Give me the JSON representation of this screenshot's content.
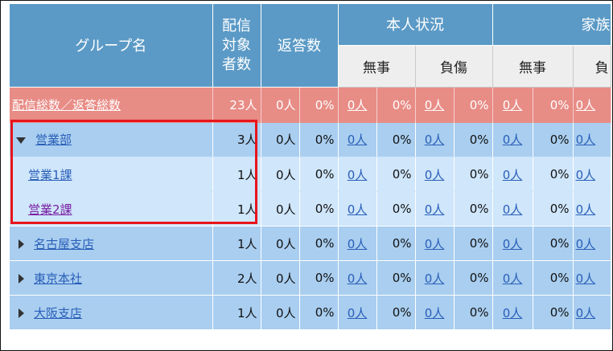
{
  "header": {
    "group_name": "グループ名",
    "recipients_line1": "配信",
    "recipients_line2": "対象",
    "recipients_line3": "者数",
    "responses": "返答数",
    "self_status": "本人状況",
    "family_status": "家族",
    "safe": "無事",
    "injured": "負傷",
    "injured_partial": "負"
  },
  "total": {
    "label": "配信総数／返答総数",
    "recipients": "23人",
    "responses_count": "0人",
    "responses_pct": "0%",
    "self_safe_count": "0人",
    "self_safe_pct": "0%",
    "self_injured_count": "0人",
    "self_injured_pct": "0%",
    "family_safe_count": "0人",
    "family_safe_pct": "0%",
    "family_injured_count": "0人"
  },
  "rows": [
    {
      "name": "営業部",
      "recipients": "3人",
      "responses": "0人",
      "responses_pct": "0%",
      "self_safe": "0人",
      "self_safe_pct": "0%",
      "self_injured": "0人",
      "self_injured_pct": "0%",
      "family_safe": "0人",
      "family_safe_pct": "0%",
      "family_injured": "0人",
      "expanded": true
    },
    {
      "name": "営業1課",
      "recipients": "1人",
      "responses": "0人",
      "responses_pct": "0%",
      "self_safe": "0人",
      "self_safe_pct": "0%",
      "self_injured": "0人",
      "self_injured_pct": "0%",
      "family_safe": "0人",
      "family_safe_pct": "0%",
      "family_injured": "0人"
    },
    {
      "name": "営業2課",
      "recipients": "1人",
      "responses": "0人",
      "responses_pct": "0%",
      "self_safe": "0人",
      "self_safe_pct": "0%",
      "self_injured": "0人",
      "self_injured_pct": "0%",
      "family_safe": "0人",
      "family_safe_pct": "0%",
      "family_injured": "0人"
    },
    {
      "name": "名古屋支店",
      "recipients": "1人",
      "responses": "0人",
      "responses_pct": "0%",
      "self_safe": "0人",
      "self_safe_pct": "0%",
      "self_injured": "0人",
      "self_injured_pct": "0%",
      "family_safe": "0人",
      "family_safe_pct": "0%",
      "family_injured": "0人",
      "expanded": false
    },
    {
      "name": "東京本社",
      "recipients": "2人",
      "responses": "0人",
      "responses_pct": "0%",
      "self_safe": "0人",
      "self_safe_pct": "0%",
      "self_injured": "0人",
      "self_injured_pct": "0%",
      "family_safe": "0人",
      "family_safe_pct": "0%",
      "family_injured": "0人",
      "expanded": false
    },
    {
      "name": "大阪支店",
      "recipients": "1人",
      "responses": "0人",
      "responses_pct": "0%",
      "self_safe": "0人",
      "self_safe_pct": "0%",
      "self_injured": "0人",
      "self_injured_pct": "0%",
      "family_safe": "0人",
      "family_safe_pct": "0%",
      "family_injured": "0人",
      "expanded": false
    }
  ],
  "colors": {
    "header_blue": "#5b9ac6",
    "total_row": "#e88c86",
    "group_row": "#a9cef0",
    "subgroup_row": "#cfe6fb",
    "link": "#2a5fb8",
    "visited_link": "#7a1fa2",
    "highlight_border": "#e8141b"
  }
}
